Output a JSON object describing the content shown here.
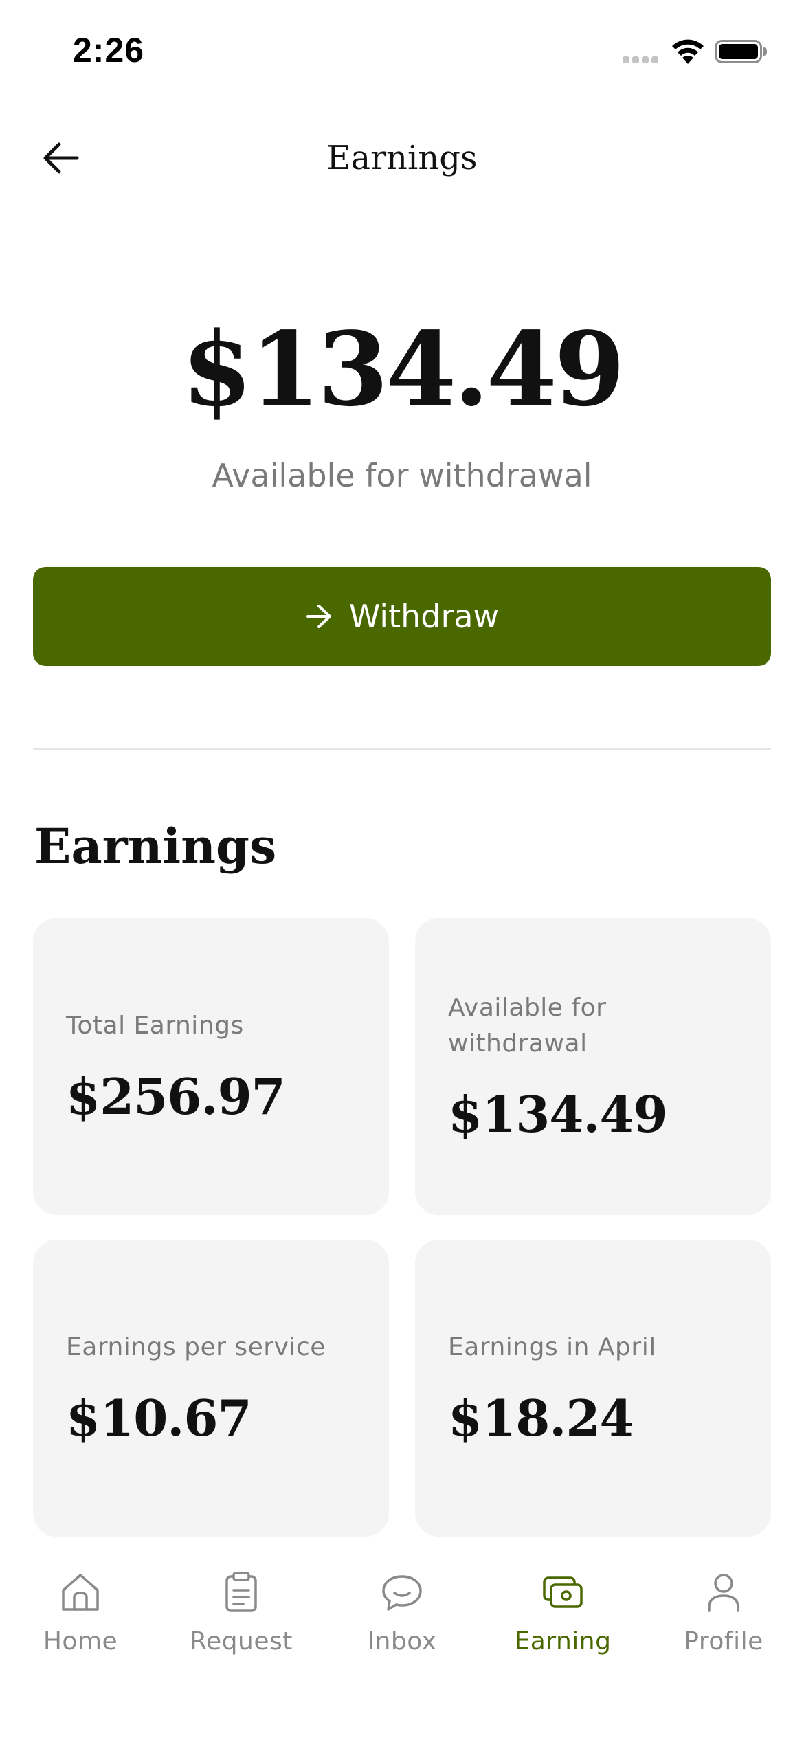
{
  "status_bar": {
    "time": "2:26"
  },
  "header": {
    "title": "Earnings",
    "back_icon": "arrow-left-icon"
  },
  "balance": {
    "amount": "$134.49",
    "caption": "Available for withdrawal"
  },
  "withdraw_button": {
    "label": "Withdraw",
    "icon": "arrow-right-icon",
    "color": "#4a6800"
  },
  "earnings_section": {
    "title": "Earnings",
    "cards": [
      {
        "label": "Total Earnings",
        "value": "$256.97"
      },
      {
        "label": "Available for withdrawal",
        "value": "$134.49"
      },
      {
        "label": "Earnings per service",
        "value": "$10.67"
      },
      {
        "label": "Earnings in April",
        "value": "$18.24"
      }
    ]
  },
  "tab_bar": {
    "active_color": "#4a6800",
    "inactive_color": "#8a8a8a",
    "tabs": [
      {
        "label": "Home",
        "icon": "home-icon",
        "active": false
      },
      {
        "label": "Request",
        "icon": "clipboard-icon",
        "active": false
      },
      {
        "label": "Inbox",
        "icon": "chat-bubble-icon",
        "active": false
      },
      {
        "label": "Earning",
        "icon": "wallet-icon",
        "active": true
      },
      {
        "label": "Profile",
        "icon": "person-icon",
        "active": false
      }
    ]
  }
}
